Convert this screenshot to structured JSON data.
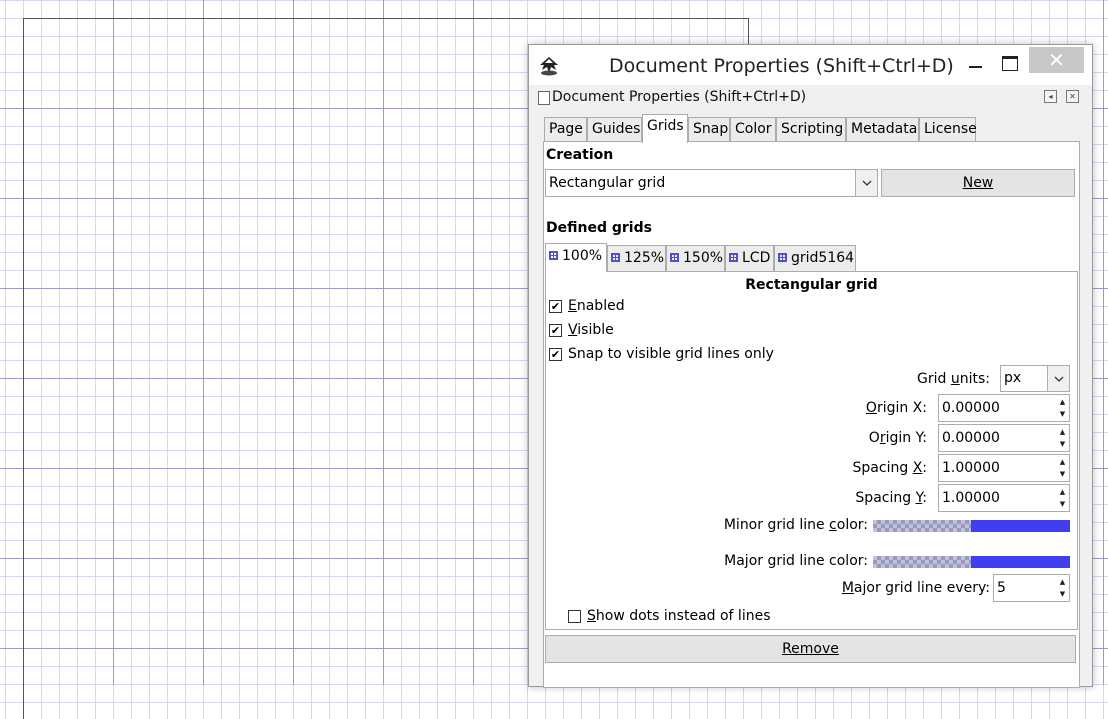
{
  "dialog": {
    "title": "Document Properties (Shift+Ctrl+D)",
    "panel_title": "Document Properties (Shift+Ctrl+D)",
    "close_glyph": "✕"
  },
  "tabs": [
    {
      "label": "Page"
    },
    {
      "label": "Guides"
    },
    {
      "label": "Grids",
      "active": true
    },
    {
      "label": "Snap"
    },
    {
      "label": "Color"
    },
    {
      "label": "Scripting"
    },
    {
      "label": "Metadata"
    },
    {
      "label": "License"
    }
  ],
  "creation": {
    "heading": "Creation",
    "grid_type": "Rectangular grid",
    "new_button": "New"
  },
  "defined_grids": {
    "heading": "Defined grids",
    "tabs": [
      {
        "label": "100%",
        "active": true
      },
      {
        "label": "125%"
      },
      {
        "label": "150%"
      },
      {
        "label": "LCD"
      },
      {
        "label": "grid5164"
      }
    ]
  },
  "grid": {
    "title": "Rectangular grid",
    "enabled": {
      "label": "Enabled",
      "checked": true
    },
    "visible": {
      "label": "Visible",
      "checked": true
    },
    "snap_visible": {
      "label": "Snap to visible grid lines only",
      "checked": true
    },
    "units": {
      "label": "Grid units:",
      "value": "px"
    },
    "origin_x": {
      "label": "Origin X:",
      "value": "0.00000"
    },
    "origin_y": {
      "label": "Origin Y:",
      "value": "0.00000"
    },
    "spacing_x": {
      "label": "Spacing X:",
      "value": "1.00000"
    },
    "spacing_y": {
      "label": "Spacing Y:",
      "value": "1.00000"
    },
    "minor_color": {
      "label": "Minor grid line color:",
      "color": "#3f3ff0"
    },
    "major_color": {
      "label": "Major grid line color:",
      "color": "#3f3ff0"
    },
    "major_every": {
      "label": "Major grid line every:",
      "value": "5"
    },
    "show_dots": {
      "label": "Show dots instead of lines",
      "checked": false
    }
  },
  "remove_button": "Remove",
  "colors": {
    "canvas_grid": "#cdcdf0",
    "accent": "#3f3ff0"
  }
}
